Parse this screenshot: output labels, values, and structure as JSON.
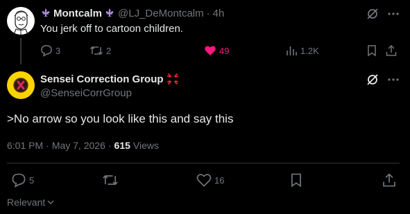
{
  "reply": {
    "display_name": "Montcalm",
    "handle": "@LJ_DeMontcalm",
    "separator": "·",
    "time": "4h",
    "text": "You jerk off to cartoon children.",
    "actions": {
      "replies": "3",
      "reposts": "2",
      "likes": "49",
      "views": "1.2K"
    }
  },
  "tweet": {
    "display_name": "Sensei Correction Group",
    "handle": "@SenseiCorrGroup",
    "text": ">No arrow so you look like this and say this",
    "time": "6:01 PM",
    "separator": "·",
    "date": "May 7, 2026",
    "views_count": "615",
    "views_label": "Views",
    "actions": {
      "replies": "5",
      "likes": "16"
    }
  },
  "sort": {
    "label": "Relevant"
  },
  "colors": {
    "background": "#000000",
    "muted": "#71767b",
    "text": "#e7e9ea",
    "like": "#f91880",
    "fleur": "#a78bda",
    "avatar2_bg": "#fcd400",
    "anger": "#f4212e"
  },
  "icons": [
    "avatar-sketch",
    "fleur-de-lis-icon",
    "grok-icon",
    "more-icon",
    "reply-icon",
    "repost-icon",
    "heart-icon",
    "views-icon",
    "bookmark-icon",
    "share-icon",
    "anger-icon",
    "chevron-down-icon"
  ]
}
